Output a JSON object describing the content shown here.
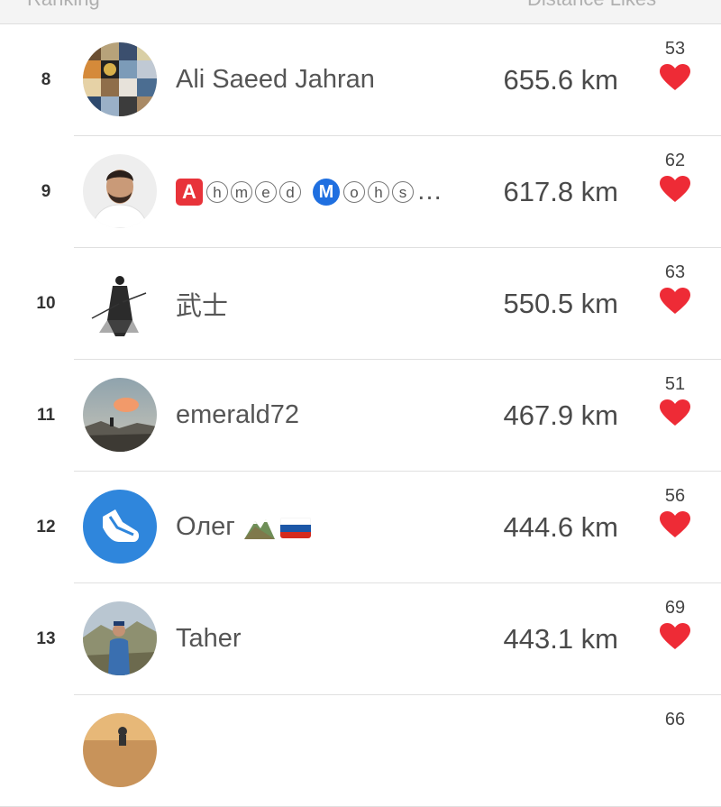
{
  "header": {
    "left_ghost": "Ranking",
    "right_ghost": "Distance  Likes"
  },
  "colors": {
    "heart": "#ee2b36",
    "text_primary": "#555555",
    "divider": "#e0e0e0"
  },
  "entries": [
    {
      "rank": "8",
      "name": "Ali Saeed Jahran",
      "distance": "655.6 km",
      "likes": "53",
      "avatar": "photo-collage-avatar"
    },
    {
      "rank": "9",
      "name_parts": [
        "A",
        "hmed",
        "M",
        "ohs",
        "…"
      ],
      "distance": "617.8 km",
      "likes": "62",
      "avatar": "man-selfie-avatar"
    },
    {
      "rank": "10",
      "name": "武士",
      "distance": "550.5 km",
      "likes": "63",
      "avatar": "samurai-avatar"
    },
    {
      "rank": "11",
      "name": "emerald72",
      "distance": "467.9 km",
      "likes": "51",
      "avatar": "sunset-landscape-avatar"
    },
    {
      "rank": "12",
      "name": "Олег",
      "name_icons": [
        "mountain-emoji",
        "russia-flag-emoji"
      ],
      "distance": "444.6 km",
      "likes": "56",
      "avatar": "shoe-logo-avatar"
    },
    {
      "rank": "13",
      "name": "Taher",
      "distance": "443.1 km",
      "likes": "69",
      "avatar": "mountain-man-avatar"
    },
    {
      "rank": "",
      "name": "",
      "distance": "",
      "likes": "66",
      "avatar": "sunset-silhouette-avatar"
    }
  ]
}
